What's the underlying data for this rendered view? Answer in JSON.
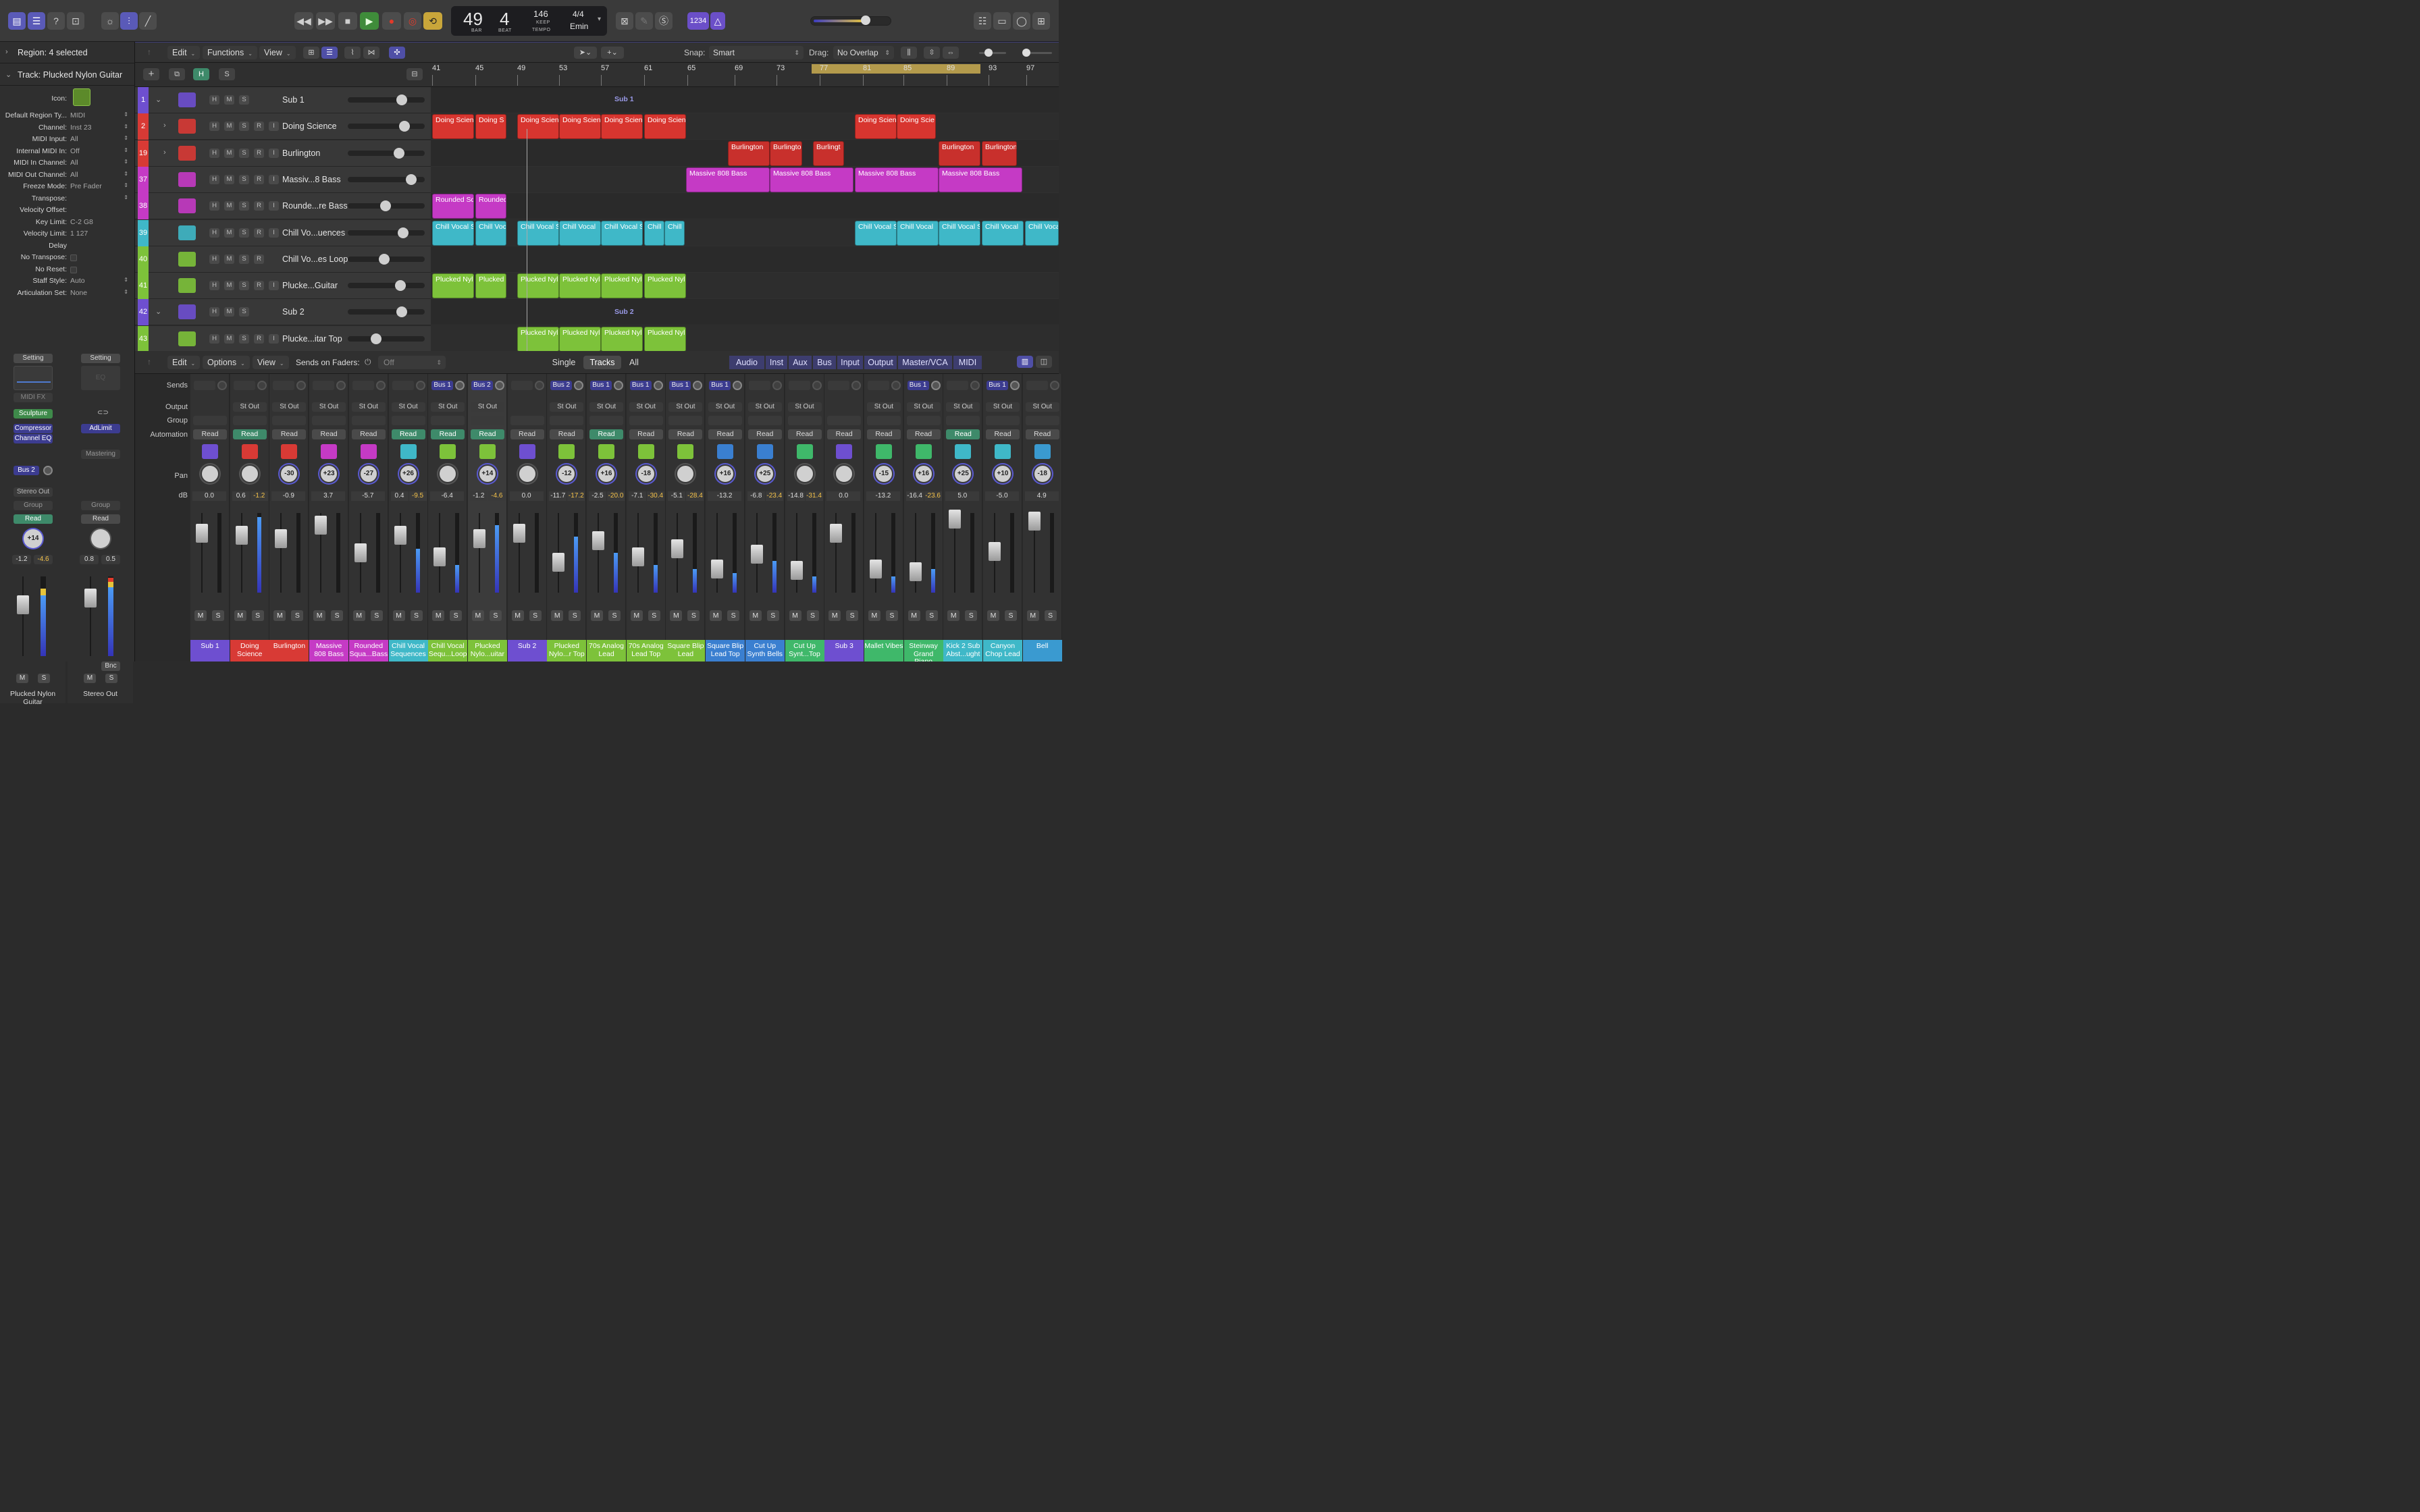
{
  "control_bar": {
    "lcd": {
      "bar": "49",
      "beat": "4",
      "bar_label": "BAR",
      "beat_label": "BEAT",
      "tempo": "146",
      "tempo_sub": "KEEP",
      "tempo_label": "TEMPO",
      "signature": "4/4",
      "key": "Emin"
    },
    "count_in": "1234"
  },
  "inspector": {
    "region_header": "Region: 4 selected",
    "track_header": "Track: Plucked Nylon Guitar",
    "icon_label": "Icon:",
    "params": [
      {
        "label": "Default Region Ty...",
        "value": "MIDI",
        "arrows": true
      },
      {
        "label": "Channel:",
        "value": "Inst 23",
        "arrows": true
      },
      {
        "label": "MIDI Input:",
        "value": "All",
        "arrows": true
      },
      {
        "label": "Internal MIDI In:",
        "value": "Off",
        "arrows": true
      },
      {
        "label": "MIDI In Channel:",
        "value": "All",
        "arrows": true
      },
      {
        "label": "MIDI Out Channel:",
        "value": "All",
        "arrows": true
      },
      {
        "label": "Freeze Mode:",
        "value": "Pre Fader",
        "arrows": true
      },
      {
        "label": "Transpose:",
        "value": "",
        "arrows": true
      },
      {
        "label": "Velocity Offset:",
        "value": "",
        "arrows": false
      },
      {
        "label": "Key Limit:",
        "value": "C-2  G8",
        "arrows": false
      },
      {
        "label": "Velocity Limit:",
        "value": "1  127",
        "arrows": false
      },
      {
        "label": "Delay",
        "value": "",
        "arrows": false
      },
      {
        "label": "No Transpose:",
        "value": "",
        "check": true
      },
      {
        "label": "No Reset:",
        "value": "",
        "check": true
      },
      {
        "label": "Staff Style:",
        "value": "Auto",
        "arrows": true
      },
      {
        "label": "Articulation Set:",
        "value": "None",
        "arrows": true
      }
    ],
    "strip1": {
      "setting": "Setting",
      "midi_fx": "MIDI FX",
      "plugins": [
        "Sculpture",
        "Compressor",
        "Channel EQ"
      ],
      "send": "Bus 2",
      "output": "Stereo Out",
      "group": "Group",
      "automation": "Read",
      "pan": "+14",
      "db": "-1.2",
      "peak": "-4.6",
      "name": "Plucked Nylon Guitar"
    },
    "strip2": {
      "setting": "Setting",
      "eq": "EQ",
      "plugin": "AdLimit",
      "mastering": "Mastering",
      "group": "Group",
      "automation": "Read",
      "db": "0.8",
      "peak": "0.5",
      "bnc": "Bnc",
      "name": "Stereo Out"
    }
  },
  "tracks_area": {
    "menus": [
      "Edit",
      "Functions",
      "View"
    ],
    "snap_label": "Snap:",
    "snap_value": "Smart",
    "drag_label": "Drag:",
    "drag_value": "No Overlap",
    "header_buttons": [
      "+",
      "⧉",
      "H",
      "S"
    ],
    "ruler": [
      "41",
      "45",
      "49",
      "53",
      "57",
      "61",
      "65",
      "69",
      "73",
      "77",
      "81",
      "85",
      "89",
      "93",
      "97"
    ],
    "tracks": [
      {
        "num": "1",
        "name": "Sub 1",
        "color": "#6e4fd0",
        "folder": true,
        "rec": false
      },
      {
        "num": "2",
        "name": "Doing Science",
        "color": "#d83a35",
        "folder": false,
        "rec": true
      },
      {
        "num": "19",
        "name": "Burlington",
        "color": "#d83a35",
        "folder": false,
        "rec": true
      },
      {
        "num": "37",
        "name": "Massiv...8 Bass",
        "color": "#c53ac5",
        "folder": false,
        "rec": true
      },
      {
        "num": "38",
        "name": "Rounde...re Bass",
        "color": "#c53ac5",
        "folder": false,
        "rec": true
      },
      {
        "num": "39",
        "name": "Chill Vo...uences",
        "color": "#3fb8c8",
        "folder": false,
        "rec": true
      },
      {
        "num": "40",
        "name": "Chill Vo...es Loop",
        "color": "#7dc23a",
        "folder": false,
        "rec": false
      },
      {
        "num": "41",
        "name": "Plucke...Guitar",
        "color": "#7dc23a",
        "folder": false,
        "rec": true
      },
      {
        "num": "42",
        "name": "Sub 2",
        "color": "#6e4fd0",
        "folder": true,
        "rec": false
      },
      {
        "num": "43",
        "name": "Plucke...itar Top",
        "color": "#7dc23a",
        "folder": false,
        "rec": true
      }
    ],
    "sub_labels": [
      "Sub 1",
      "Sub 2"
    ],
    "regions": {
      "doing": [
        "Doing Scien",
        "Doing S",
        "Doing Scien",
        "Doing Scien",
        "Doing Scien",
        "Doing Scien",
        "Doing Scien",
        "Doing Scie"
      ],
      "burl": [
        "Burlington",
        "Burlingto",
        "Burlingt",
        "Burlington",
        "Burlington"
      ],
      "massive": [
        "Massive 808 Bass",
        "Massive 808 Bass",
        "Massive 808 Bass",
        "Massive 808 Bass"
      ],
      "rounded": [
        "Rounded Sq",
        "Rounded"
      ],
      "chill": [
        "Chill Vocal S",
        "Chill Voc",
        "Chill Vocal S",
        "Chill Vocal",
        "Chill Vocal S",
        "Chill",
        "Chill",
        "Chill Vocal S",
        "Chill Vocal",
        "Chill Vocal S",
        "Chill Vocal",
        "Chill Voca"
      ],
      "pluck": [
        "Plucked Nyl",
        "Plucked",
        "Plucked Nyl",
        "Plucked Nyl",
        "Plucked Nyl",
        "Plucked Nyl"
      ],
      "pluck2": [
        "Plucked Nyl",
        "Plucked Nyl",
        "Plucked Nyl",
        "Plucked Nyl"
      ]
    }
  },
  "mixer": {
    "menus": [
      "Edit",
      "Options",
      "View"
    ],
    "sends_on_faders": "Sends on Faders:",
    "sends_value": "Off",
    "modes": [
      "Single",
      "Tracks",
      "All"
    ],
    "filters": [
      "Audio",
      "Inst",
      "Aux",
      "Bus",
      "Input",
      "Output",
      "Master/VCA",
      "MIDI"
    ],
    "row_labels": [
      "Sends",
      "Output",
      "Group",
      "Automation",
      "Pan",
      "dB"
    ],
    "strips": [
      {
        "name": "Sub 1",
        "color": "#6e4fd0",
        "send": "",
        "out": "",
        "auto": "Read",
        "ag": false,
        "pan": "",
        "db": "0.0",
        "pk": "",
        "fader": 0.75,
        "meter": 0
      },
      {
        "name": "Doing Science",
        "color": "#d83a35",
        "send": "",
        "out": "St Out",
        "auto": "Read",
        "ag": true,
        "pan": "",
        "db": "0.6",
        "pk": "-1.2",
        "fader": 0.72,
        "meter": 0.95
      },
      {
        "name": "Burlington",
        "color": "#d83a35",
        "send": "",
        "out": "St Out",
        "auto": "Read",
        "ag": false,
        "pan": "-30",
        "db": "-0.9",
        "pk": "",
        "fader": 0.68,
        "meter": 0
      },
      {
        "name": "Massive 808 Bass",
        "color": "#c53ac5",
        "send": "",
        "out": "St Out",
        "auto": "Read",
        "ag": false,
        "pan": "+23",
        "db": "3.7",
        "pk": "",
        "fader": 0.85,
        "meter": 0
      },
      {
        "name": "Rounded Squa...Bass",
        "color": "#c53ac5",
        "send": "",
        "out": "St Out",
        "auto": "Read",
        "ag": false,
        "pan": "-27",
        "db": "-5.7",
        "pk": "",
        "fader": 0.5,
        "meter": 0
      },
      {
        "name": "Chill Vocal Sequences",
        "color": "#3fb8c8",
        "send": "",
        "out": "St Out",
        "auto": "Read",
        "ag": true,
        "pan": "+26",
        "db": "0.4",
        "pk": "-9.5",
        "fader": 0.72,
        "meter": 0.55
      },
      {
        "name": "Chill Vocal Sequ...Loop",
        "color": "#7dc23a",
        "send": "Bus 1",
        "out": "St Out",
        "auto": "Read",
        "ag": true,
        "pan": "",
        "db": "-6.4",
        "pk": "",
        "fader": 0.45,
        "meter": 0.35
      },
      {
        "name": "Plucked Nylo...uitar",
        "color": "#7dc23a",
        "send": "Bus 2",
        "out": "St Out",
        "auto": "Read",
        "ag": true,
        "pan": "+14",
        "db": "-1.2",
        "pk": "-4.6",
        "fader": 0.68,
        "meter": 0.85,
        "sel": true
      },
      {
        "name": "Sub 2",
        "color": "#6e4fd0",
        "send": "",
        "out": "",
        "auto": "Read",
        "ag": false,
        "pan": "",
        "db": "0.0",
        "pk": "",
        "fader": 0.75,
        "meter": 0
      },
      {
        "name": "Plucked Nylo...r Top",
        "color": "#7dc23a",
        "send": "Bus 2",
        "out": "St Out",
        "auto": "Read",
        "ag": false,
        "pan": "-12",
        "db": "-11.7",
        "pk": "-17.2",
        "fader": 0.38,
        "meter": 0.7
      },
      {
        "name": "70s Analog Lead",
        "color": "#7dc23a",
        "send": "Bus 1",
        "out": "St Out",
        "auto": "Read",
        "ag": true,
        "pan": "+16",
        "db": "-2.5",
        "pk": "-20.0",
        "fader": 0.65,
        "meter": 0.5
      },
      {
        "name": "70s Analog Lead Top",
        "color": "#7dc23a",
        "send": "Bus 1",
        "out": "St Out",
        "auto": "Read",
        "ag": false,
        "pan": "-18",
        "db": "-7.1",
        "pk": "-30.4",
        "fader": 0.45,
        "meter": 0.35
      },
      {
        "name": "Square Blip Lead",
        "color": "#7dc23a",
        "send": "Bus 1",
        "out": "St Out",
        "auto": "Read",
        "ag": false,
        "pan": "",
        "db": "-5.1",
        "pk": "-28.4",
        "fader": 0.55,
        "meter": 0.3
      },
      {
        "name": "Square Blip Lead Top",
        "color": "#3a7fd0",
        "send": "Bus 1",
        "out": "St Out",
        "auto": "Read",
        "ag": false,
        "pan": "+16",
        "db": "-13.2",
        "pk": "",
        "fader": 0.3,
        "meter": 0.25
      },
      {
        "name": "Cut Up Synth Bells",
        "color": "#3a7fd0",
        "send": "",
        "out": "St Out",
        "auto": "Read",
        "ag": false,
        "pan": "+25",
        "db": "-6.8",
        "pk": "-23.4",
        "fader": 0.48,
        "meter": 0.4
      },
      {
        "name": "Cut Up Synt...Top",
        "color": "#3fb86a",
        "send": "",
        "out": "St Out",
        "auto": "Read",
        "ag": false,
        "pan": "",
        "db": "-14.8",
        "pk": "-31.4",
        "fader": 0.28,
        "meter": 0.2
      },
      {
        "name": "Sub 3",
        "color": "#6e4fd0",
        "send": "",
        "out": "",
        "auto": "Read",
        "ag": false,
        "pan": "",
        "db": "0.0",
        "pk": "",
        "fader": 0.75,
        "meter": 0
      },
      {
        "name": "Mallet Vibes",
        "color": "#3fb86a",
        "send": "",
        "out": "St Out",
        "auto": "Read",
        "ag": false,
        "pan": "-15",
        "db": "-13.2",
        "pk": "",
        "fader": 0.3,
        "meter": 0.2
      },
      {
        "name": "Steinway Grand Piano",
        "color": "#3fb86a",
        "send": "Bus 1",
        "out": "St Out",
        "auto": "Read",
        "ag": false,
        "pan": "+16",
        "db": "-16.4",
        "pk": "-23.6",
        "fader": 0.26,
        "meter": 0.3
      },
      {
        "name": "Kick 2 Sub Abst...ught",
        "color": "#3fb8c8",
        "send": "",
        "out": "St Out",
        "auto": "Read",
        "ag": true,
        "pan": "+25",
        "db": "5.0",
        "pk": "",
        "fader": 0.92,
        "meter": 0
      },
      {
        "name": "Canyon Chop Lead",
        "color": "#3fb8c8",
        "send": "Bus 1",
        "out": "St Out",
        "auto": "Read",
        "ag": false,
        "pan": "+10",
        "db": "-5.0",
        "pk": "",
        "fader": 0.52,
        "meter": 0
      },
      {
        "name": "Bell",
        "color": "#3a9ad0",
        "send": "",
        "out": "St Out",
        "auto": "Read",
        "ag": false,
        "pan": "-18",
        "db": "4.9",
        "pk": "",
        "fader": 0.9,
        "meter": 0
      }
    ]
  }
}
